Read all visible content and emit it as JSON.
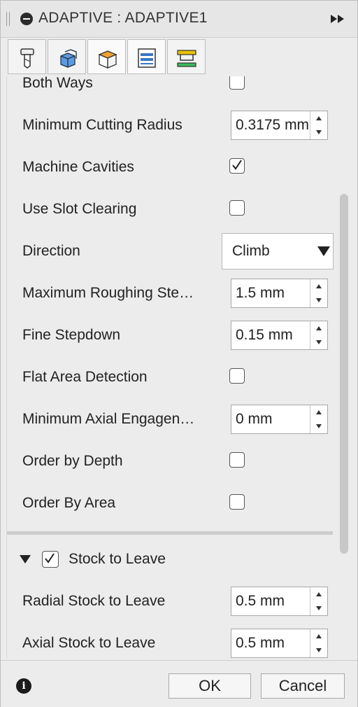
{
  "window": {
    "title": "ADAPTIVE : ADAPTIVE1"
  },
  "tabs": [
    {
      "name": "tool"
    },
    {
      "name": "geometry"
    },
    {
      "name": "heights"
    },
    {
      "name": "passes"
    },
    {
      "name": "linking"
    }
  ],
  "fields": {
    "both_ways": {
      "label": "Both Ways",
      "checked": false
    },
    "min_cutting_radius": {
      "label": "Minimum Cutting Radius",
      "value": "0.3175 mm"
    },
    "machine_cavities": {
      "label": "Machine Cavities",
      "checked": true
    },
    "use_slot_clearing": {
      "label": "Use Slot Clearing",
      "checked": false
    },
    "direction": {
      "label": "Direction",
      "value": "Climb"
    },
    "max_roughing_stepdown": {
      "label": "Maximum Roughing Ste…",
      "value": "1.5 mm"
    },
    "fine_stepdown": {
      "label": "Fine Stepdown",
      "value": "0.15 mm"
    },
    "flat_area_detection": {
      "label": "Flat Area Detection",
      "checked": false
    },
    "min_axial_engagement": {
      "label": "Minimum Axial Engagen…",
      "value": "0 mm"
    },
    "order_by_depth": {
      "label": "Order by Depth",
      "checked": false
    },
    "order_by_area": {
      "label": "Order By Area",
      "checked": false
    }
  },
  "stock_section": {
    "label": "Stock to Leave",
    "checked": true,
    "radial": {
      "label": "Radial Stock to Leave",
      "value": "0.5 mm"
    },
    "axial": {
      "label": "Axial Stock to Leave",
      "value": "0.5 mm"
    }
  },
  "footer": {
    "ok_label": "OK",
    "cancel_label": "Cancel"
  },
  "colors": {
    "panel_bg": "#ececec",
    "accent_yellow": "#e8c400",
    "accent_blue": "#3a78c4"
  }
}
